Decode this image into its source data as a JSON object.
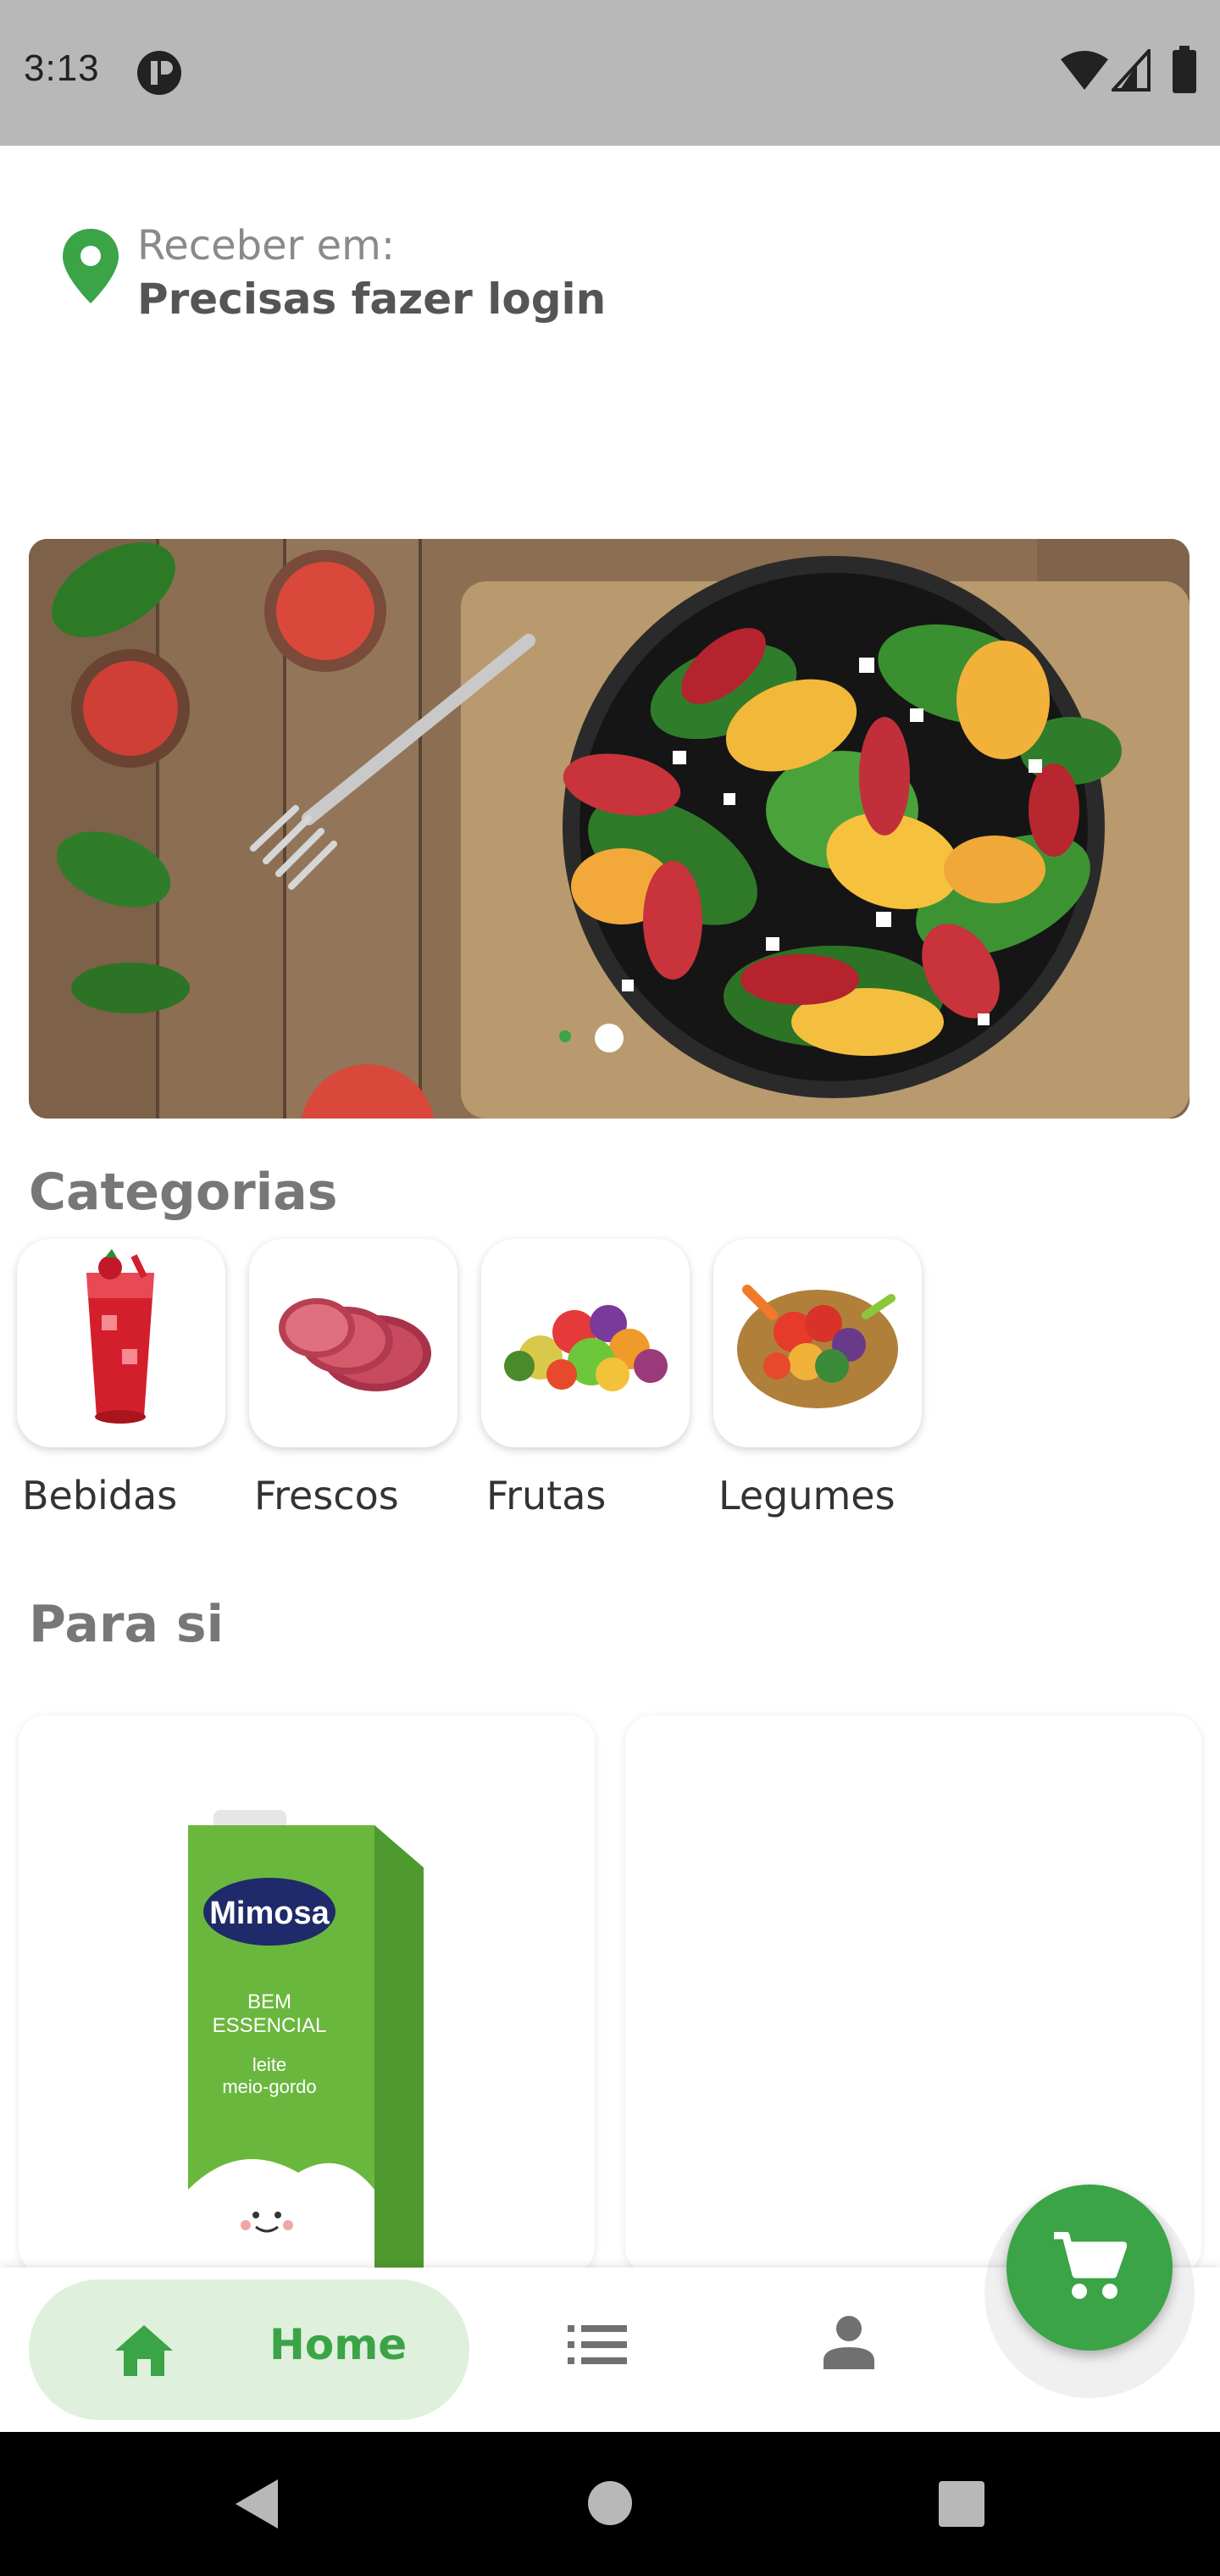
{
  "status_bar": {
    "time": "3:13",
    "icons": [
      "app-notification-icon",
      "wifi-icon",
      "signal-icon",
      "battery-icon"
    ]
  },
  "location": {
    "label": "Receber em:",
    "value": "Precisas fazer login",
    "icon": "location-pin-icon"
  },
  "banner": {
    "slides": 2,
    "active_slide": 2
  },
  "categories": {
    "title": "Categorias",
    "items": [
      {
        "label": "Bebidas"
      },
      {
        "label": "Frescos"
      },
      {
        "label": "Frutas"
      },
      {
        "label": "Legumes"
      }
    ]
  },
  "for_you": {
    "title": "Para si",
    "products": [
      {
        "brand": "Mimosa",
        "line1": "BEM",
        "line2": "ESSENCIAL",
        "line3": "leite",
        "line4": "meio-gordo"
      },
      {}
    ]
  },
  "bottom_nav": {
    "items": [
      {
        "label": "Home",
        "icon": "home-icon",
        "active": true
      },
      {
        "label": "",
        "icon": "list-icon",
        "active": false
      },
      {
        "label": "",
        "icon": "person-icon",
        "active": false
      }
    ]
  },
  "fab": {
    "icon": "cart-icon"
  },
  "colors": {
    "accent": "#3aa446",
    "accent_light": "#dff0dd",
    "status_bar": "#b8b8b8",
    "system_nav": "#000000"
  }
}
